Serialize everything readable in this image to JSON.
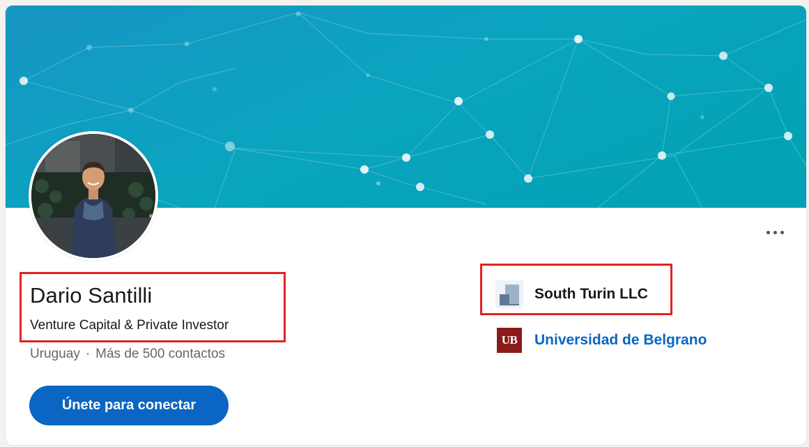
{
  "profile": {
    "name": "Dario Santilli",
    "headline": "Venture Capital & Private Investor",
    "location": "Uruguay",
    "separator": "·",
    "connections": "Más de 500 contactos"
  },
  "actions": {
    "connect_label": "Únete para conectar",
    "more_icon": "more-horizontal-icon"
  },
  "company": {
    "name": "South Turin LLC",
    "logo_icon": "company-building-icon"
  },
  "school": {
    "name": "Universidad de Belgrano",
    "logo_text": "UB"
  },
  "colors": {
    "banner_start": "#1a9bc0",
    "banner_end": "#0aa3b8",
    "primary": "#0a66c2",
    "highlight": "#e02424",
    "school_brand": "#8b1a1a"
  }
}
